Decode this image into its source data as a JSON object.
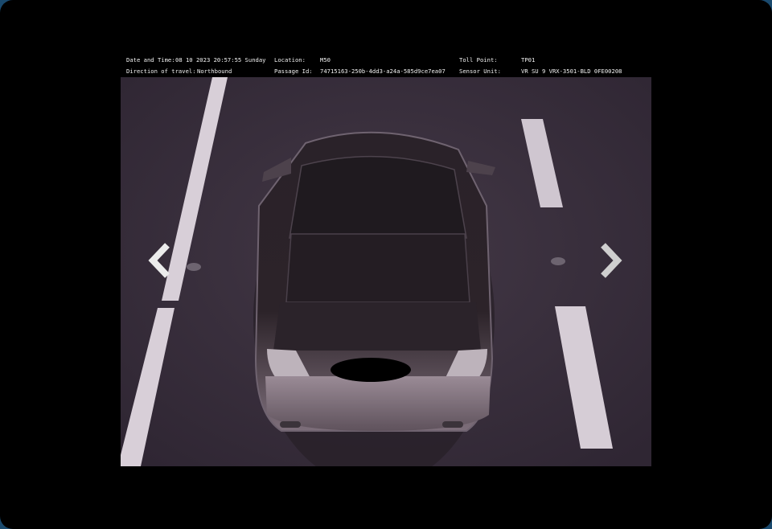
{
  "capture": {
    "date_time_label": "Date and Time:",
    "date_time_value": "08 10 2023 20:57:55 Sunday",
    "location_label": "Location:",
    "location_value": "M50",
    "toll_point_label": "Toll Point:",
    "toll_point_value": "TP01",
    "direction_label": "Direction of travel:",
    "direction_value": "Northbound",
    "passage_id_label": "Passage Id:",
    "passage_id_value": "74715163-250b-4dd3-a24a-585d9ce7ea07",
    "sensor_unit_label": "Sensor Unit:",
    "sensor_unit_value": "VR SU 9  VRX-3501-BLD  0FE00208"
  },
  "icons": {
    "prev": "chevron-left-icon",
    "next": "chevron-right-icon"
  },
  "colors": {
    "background": "#000000",
    "road": "#3a2f3c",
    "lane_marking": "#d8cfd8",
    "arrow": "#e8e8e8"
  }
}
